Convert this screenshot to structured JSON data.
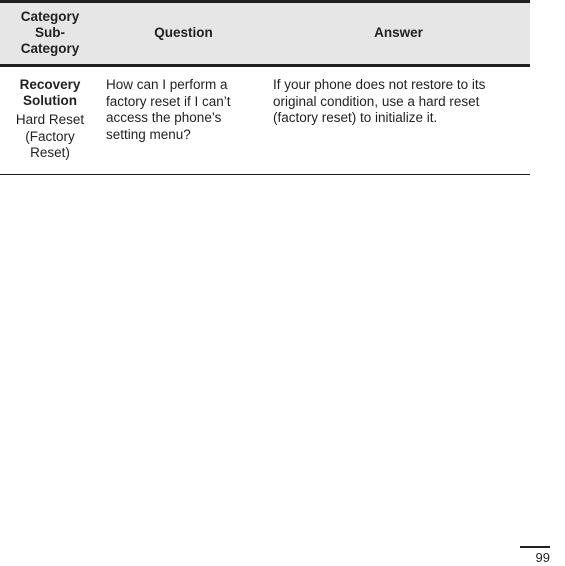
{
  "document": {
    "page_number": "99"
  },
  "table": {
    "columns": [
      {
        "id": "category",
        "label": "Category\nSub-Category",
        "label_line1": "Category",
        "label_line2": "Sub-",
        "label_line3": "Category"
      },
      {
        "id": "question",
        "label": "Question"
      },
      {
        "id": "answer",
        "label": "Answer"
      }
    ],
    "rows": [
      {
        "category_main": "Recovery Solution",
        "category_sub": "Hard Reset (Factory Reset)",
        "question": "How can I perform a factory reset if I can’t access the phone’s setting menu?",
        "answer": "If your phone does not restore to its original condition, use a hard reset (factory reset) to initialize it."
      }
    ]
  },
  "colors": {
    "header_background": "#e6e6e6",
    "text": "#231f20",
    "border": "#231f20",
    "page_background": "#ffffff"
  }
}
